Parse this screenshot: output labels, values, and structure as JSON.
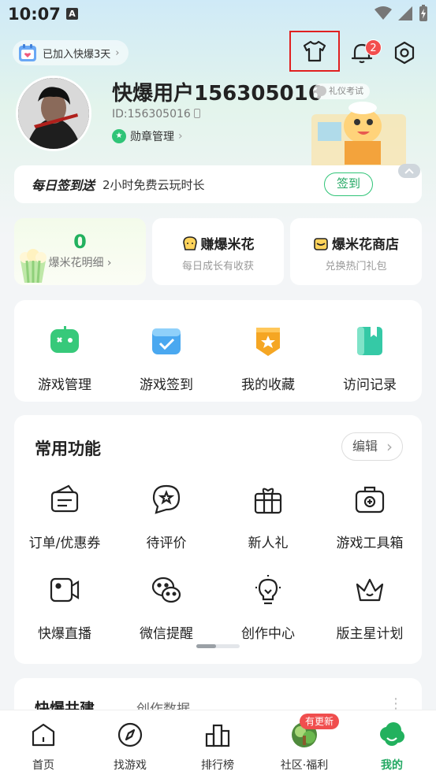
{
  "status_bar": {
    "time": "10:07",
    "notification_letter": "A"
  },
  "header": {
    "joined_text": "已加入快爆3天",
    "notification_count": "2"
  },
  "profile": {
    "username": "快爆用户156305016",
    "etiquette_tag": "礼仪考试",
    "user_id": "ID:156305016",
    "medal_label": "勋章管理"
  },
  "checkin": {
    "title": "每日签到送",
    "desc": "2小时免费云玩时长",
    "button": "签到"
  },
  "popcorn": {
    "count": "0",
    "detail_label": "爆米花明细",
    "earn_title": "赚爆米花",
    "earn_sub": "每日成长有收获",
    "shop_title": "爆米花商店",
    "shop_sub": "兑换热门礼包"
  },
  "quick_actions": [
    {
      "label": "游戏管理",
      "icon": "gamepad-icon",
      "color": "#37c97a"
    },
    {
      "label": "游戏签到",
      "icon": "calendar-check-icon",
      "color": "#4aa8f0"
    },
    {
      "label": "我的收藏",
      "icon": "star-shield-icon",
      "color": "#f5a623"
    },
    {
      "label": "访问记录",
      "icon": "bookmark-icon",
      "color": "#35c9a6"
    }
  ],
  "common_functions": {
    "title": "常用功能",
    "edit_label": "编辑",
    "items": [
      {
        "label": "订单/优惠券",
        "icon": "coupon-icon"
      },
      {
        "label": "待评价",
        "icon": "star-bubble-icon"
      },
      {
        "label": "新人礼",
        "icon": "gift-icon"
      },
      {
        "label": "游戏工具箱",
        "icon": "toolbox-icon"
      },
      {
        "label": "快爆直播",
        "icon": "video-camera-icon"
      },
      {
        "label": "微信提醒",
        "icon": "wechat-icon"
      },
      {
        "label": "创作中心",
        "icon": "lightbulb-icon"
      },
      {
        "label": "版主星计划",
        "icon": "crown-icon"
      }
    ]
  },
  "cobuild": {
    "title": "快爆共建",
    "tab": "创作数据"
  },
  "bottom_nav": {
    "items": [
      {
        "label": "首页",
        "icon": "home-icon"
      },
      {
        "label": "找游戏",
        "icon": "compass-icon"
      },
      {
        "label": "排行榜",
        "icon": "bar-chart-icon"
      },
      {
        "label": "社区·福利",
        "icon": "community-icon"
      },
      {
        "label": "我的",
        "icon": "profile-cloud-icon"
      }
    ],
    "update_badge": "有更新",
    "active_index": 4
  },
  "colors": {
    "accent_green": "#22a862",
    "highlight_red": "#e02020",
    "badge_red": "#f24e4e"
  }
}
